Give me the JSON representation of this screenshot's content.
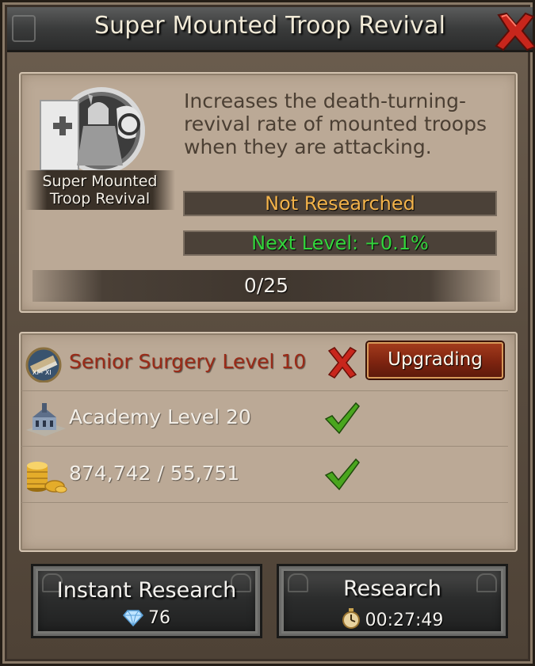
{
  "window": {
    "title": "Super Mounted Troop Revival",
    "close_icon": "close-x-icon"
  },
  "skill": {
    "portrait_icon": "mounted-knight-portrait-icon",
    "name_line1": "Super Mounted",
    "name_line2": "Troop Revival",
    "description": "Increases the death-turning-revival rate of mounted troops when they are attacking.",
    "status": "Not Researched",
    "next_level": "Next Level: +0.1%",
    "progress_text": "0/25",
    "progress_fraction": 0
  },
  "requirements": [
    {
      "icon": "surgery-tools-icon",
      "label": "Senior Surgery Level 10",
      "label_color": "#9a2a17",
      "met": false,
      "action_label": "Upgrading"
    },
    {
      "icon": "academy-building-icon",
      "label": "Academy Level 20",
      "label_color": "#f3efe8",
      "met": true
    },
    {
      "icon": "gold-coins-icon",
      "label": "874,742 / 55,751",
      "label_color": "#f3efe8",
      "met": true
    }
  ],
  "buttons": {
    "instant": {
      "label": "Instant Research",
      "cost": "76",
      "cost_icon": "diamond-icon"
    },
    "research": {
      "label": "Research",
      "time": "00:27:49",
      "time_icon": "stopwatch-icon"
    }
  },
  "colors": {
    "status": "#f2b24a",
    "next_level": "#33d43c",
    "requirement_unmet": "#9a2a17",
    "check": "#4aa61e",
    "cross": "#c8261c"
  }
}
